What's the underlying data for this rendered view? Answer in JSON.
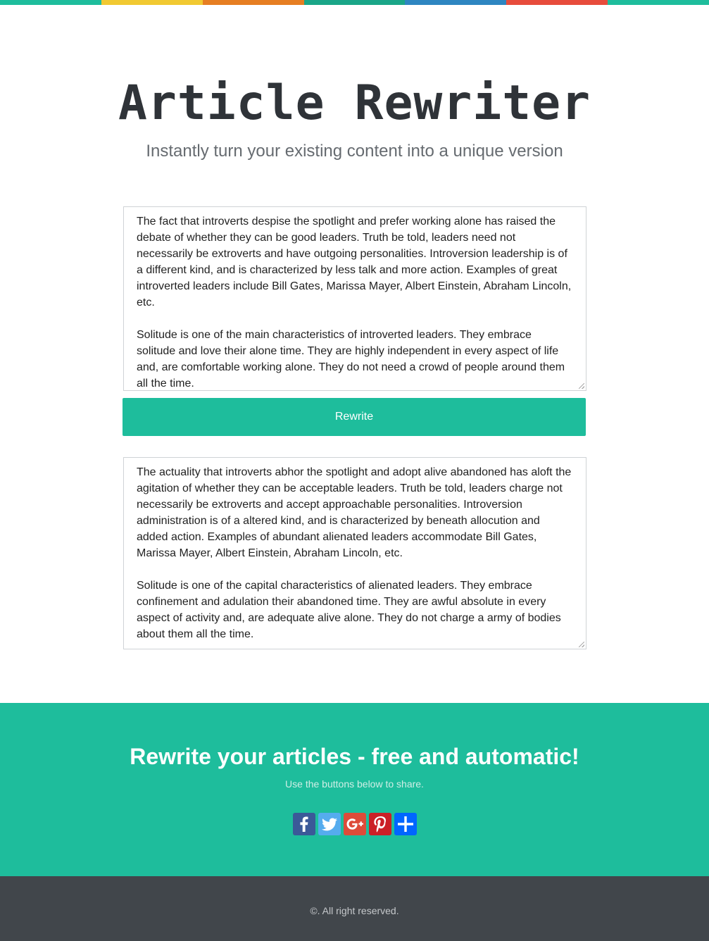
{
  "stripe_colors": [
    "#1ebd9c",
    "#f1c932",
    "#e67e22",
    "#1aa688",
    "#2e86c1",
    "#e74c3c",
    "#1ebd9c"
  ],
  "header": {
    "title": "Article Rewriter",
    "subtitle": "Instantly turn your existing content into a unique version"
  },
  "input": {
    "paragraphs": [
      "The fact that introverts despise the spotlight and prefer working alone has raised the debate of whether they can be good leaders. Truth be told, leaders need not necessarily be extroverts and have outgoing personalities. Introversion leadership is of a different kind, and is characterized by less talk and more action. Examples of great introverted leaders include Bill Gates, Marissa Mayer, Albert Einstein, Abraham Lincoln, etc.",
      "Solitude is one of the main characteristics of introverted leaders. They embrace solitude and love their alone time. They are highly independent in every aspect of life and, are comfortable working alone. They do not need a crowd of people around them all the time."
    ]
  },
  "rewrite_button": {
    "label": "Rewrite",
    "color": "#1ebd9c"
  },
  "output": {
    "paragraphs": [
      "The actuality that introverts abhor the spotlight and adopt alive abandoned has aloft the agitation of whether they can be acceptable leaders. Truth be told, leaders charge not necessarily be extroverts and accept approachable personalities. Introversion administration is of a altered kind, and is characterized by beneath allocution and added action. Examples of abundant alienated leaders accommodate Bill Gates, Marissa Mayer, Albert Einstein, Abraham Lincoln, etc.",
      "Solitude is one of the capital characteristics of alienated leaders. They embrace confinement and adulation their abandoned time. They are awful absolute in every aspect of activity and, are adequate alive alone. They do not charge a army of bodies about them all the time."
    ]
  },
  "share": {
    "heading": "Rewrite your articles - free and automatic!",
    "subheading": "Use the buttons below to share.",
    "buttons": [
      {
        "icon": "facebook-icon",
        "color": "#3b5998"
      },
      {
        "icon": "twitter-icon",
        "color": "#55acee"
      },
      {
        "icon": "google-plus-icon",
        "color": "#dd4b39"
      },
      {
        "icon": "pinterest-icon",
        "color": "#cb2027"
      },
      {
        "icon": "share-plus-icon",
        "color": "#0166ff"
      }
    ]
  },
  "footer": {
    "copyright": "©. All right reserved."
  }
}
